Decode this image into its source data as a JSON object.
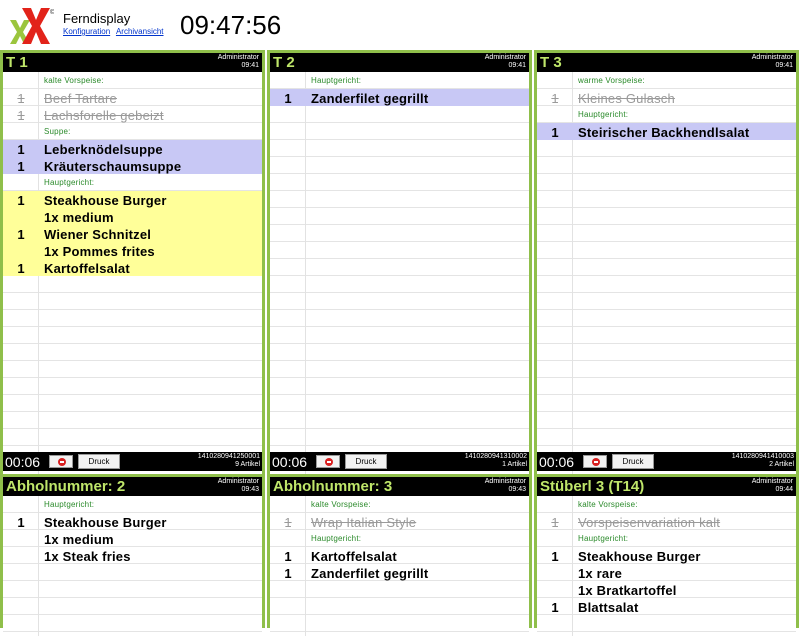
{
  "app": {
    "title": "Ferndisplay",
    "links": [
      "Konfiguration",
      "Archivansicht"
    ],
    "clock": "09:47:56",
    "logo": "xx-logo"
  },
  "panels": [
    {
      "title": "T 1",
      "user": "Administrator",
      "time": "09:41",
      "footer": {
        "timer": "00:06",
        "print": "Druck",
        "id": "1410280941250001",
        "count": "9 Artikel"
      },
      "rows": [
        {
          "type": "cat",
          "name": "kalte Vorspeise:"
        },
        {
          "type": "done",
          "qty": "1",
          "name": "Beef Tartare"
        },
        {
          "type": "done",
          "qty": "1",
          "name": "Lachsforelle gebeizt"
        },
        {
          "type": "cat",
          "name": "Suppe:"
        },
        {
          "type": "blue",
          "qty": "1",
          "name": "Leberknödelsuppe"
        },
        {
          "type": "blue",
          "qty": "1",
          "name": "Kräuterschaumsuppe"
        },
        {
          "type": "cat",
          "name": "Hauptgericht:"
        },
        {
          "type": "yellow",
          "qty": "1",
          "name": "Steakhouse Burger"
        },
        {
          "type": "yellow",
          "qty": "",
          "name": "1x medium"
        },
        {
          "type": "yellow",
          "qty": "1",
          "name": "Wiener Schnitzel"
        },
        {
          "type": "yellow",
          "qty": "",
          "name": "1x Pommes frites"
        },
        {
          "type": "yellow",
          "qty": "1",
          "name": "Kartoffelsalat"
        }
      ]
    },
    {
      "title": "T 2",
      "user": "Administrator",
      "time": "09:41",
      "footer": {
        "timer": "00:06",
        "print": "Druck",
        "id": "1410280941310002",
        "count": "1 Artikel"
      },
      "rows": [
        {
          "type": "cat",
          "name": "Hauptgericht:"
        },
        {
          "type": "blue",
          "qty": "1",
          "name": "Zanderfilet gegrillt"
        }
      ]
    },
    {
      "title": "T 3",
      "user": "Administrator",
      "time": "09:41",
      "footer": {
        "timer": "00:06",
        "print": "Druck",
        "id": "1410280941410003",
        "count": "2 Artikel"
      },
      "rows": [
        {
          "type": "cat",
          "name": "warme Vorspeise:"
        },
        {
          "type": "done",
          "qty": "1",
          "name": "Kleines Gulasch"
        },
        {
          "type": "cat",
          "name": "Hauptgericht:"
        },
        {
          "type": "blue",
          "qty": "1",
          "name": "Steirischer Backhendlsalat"
        }
      ]
    },
    {
      "title": "Abholnummer: 2",
      "user": "Administrator",
      "time": "09:43",
      "rows": [
        {
          "type": "cat",
          "name": "Hauptgericht:"
        },
        {
          "type": "normal",
          "qty": "1",
          "name": "Steakhouse Burger"
        },
        {
          "type": "normal",
          "qty": "",
          "name": "1x medium"
        },
        {
          "type": "normal",
          "qty": "",
          "name": "1x Steak fries"
        }
      ]
    },
    {
      "title": "Abholnummer: 3",
      "user": "Administrator",
      "time": "09:43",
      "rows": [
        {
          "type": "cat",
          "name": "kalte Vorspeise:"
        },
        {
          "type": "done",
          "qty": "1",
          "name": "Wrap Italian Style"
        },
        {
          "type": "cat",
          "name": "Hauptgericht:"
        },
        {
          "type": "normal",
          "qty": "1",
          "name": "Kartoffelsalat"
        },
        {
          "type": "normal",
          "qty": "1",
          "name": "Zanderfilet gegrillt"
        }
      ]
    },
    {
      "title": "Stüberl 3 (T14)",
      "user": "Administrator",
      "time": "09:44",
      "rows": [
        {
          "type": "cat",
          "name": "kalte Vorspeise:"
        },
        {
          "type": "done",
          "qty": "1",
          "name": "Vorspeisenvariation kalt"
        },
        {
          "type": "cat",
          "name": "Hauptgericht:"
        },
        {
          "type": "normal",
          "qty": "1",
          "name": "Steakhouse Burger"
        },
        {
          "type": "normal",
          "qty": "",
          "name": "1x rare"
        },
        {
          "type": "normal",
          "qty": "",
          "name": "1x Bratkartoffel"
        },
        {
          "type": "normal",
          "qty": "1",
          "name": "Blattsalat"
        }
      ]
    }
  ]
}
